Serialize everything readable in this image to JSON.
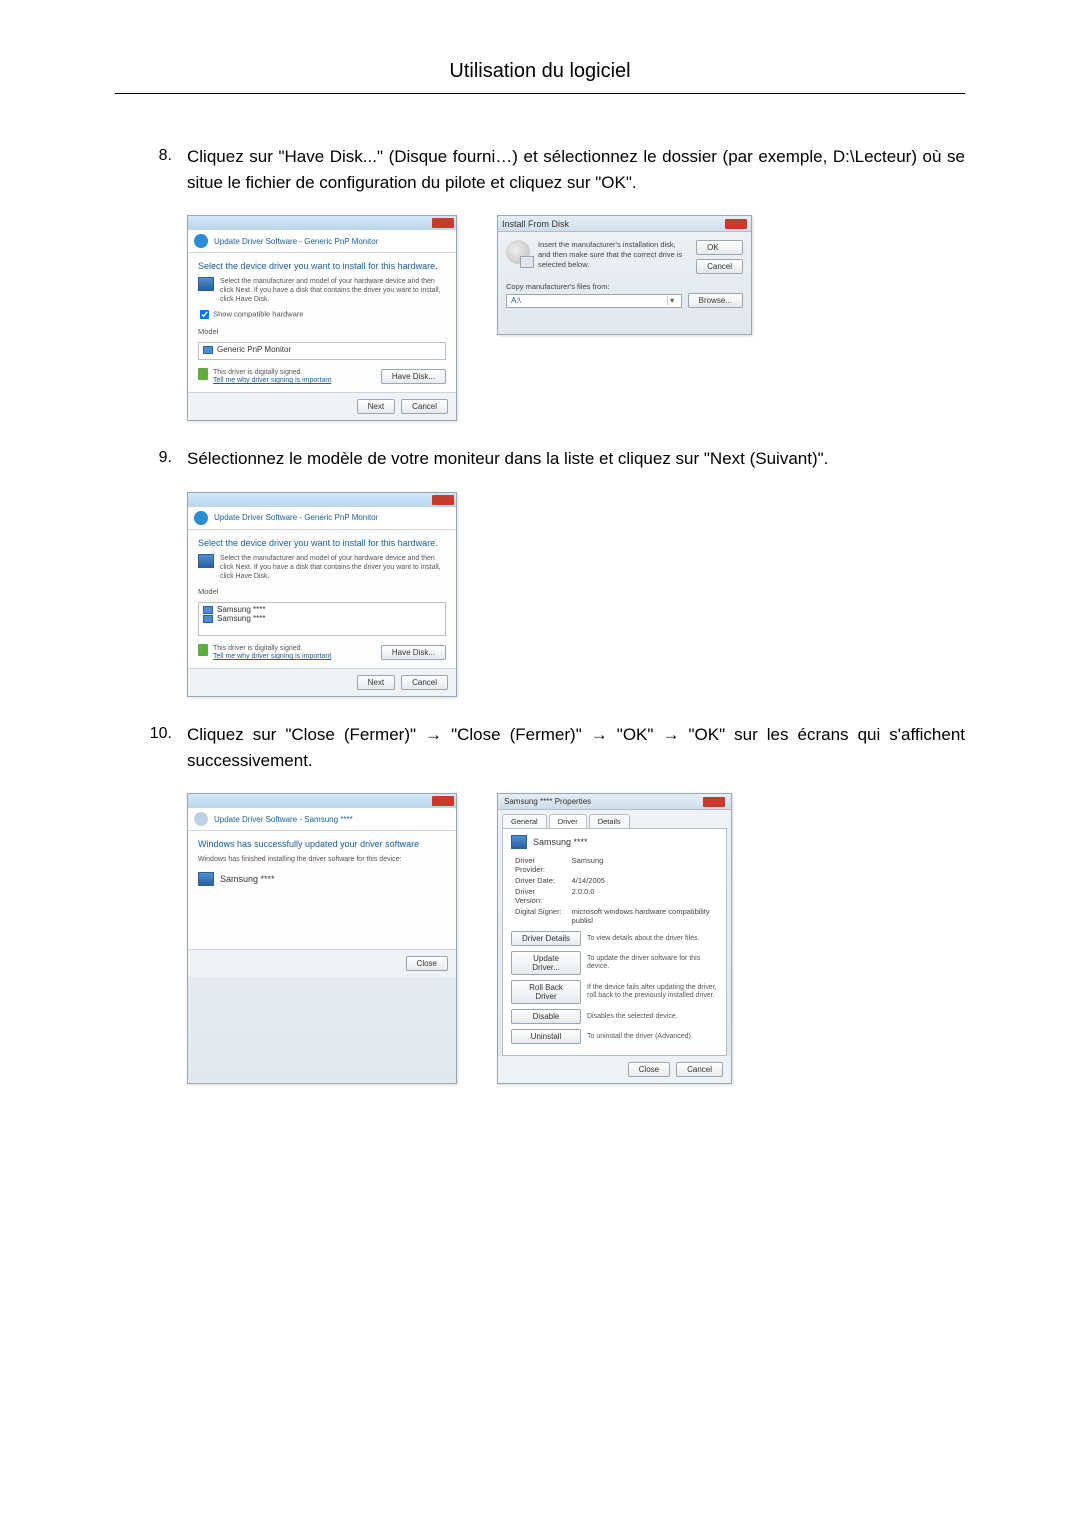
{
  "header": {
    "title": "Utilisation du logiciel"
  },
  "steps": {
    "s8": {
      "num": "8.",
      "text": "Cliquez sur \"Have Disk...\" (Disque fourni…) et sélectionnez le dossier (par exemple, D:\\Lecteur) où se situe le fichier de configuration du pilote et cliquez sur \"OK\"."
    },
    "s9": {
      "num": "9.",
      "text": "Sélectionnez le modèle de votre moniteur dans la liste et cliquez sur \"Next (Suivant)\"."
    },
    "s10": {
      "num": "10.",
      "text": "Cliquez sur \"Close (Fermer)\" → \"Close (Fermer)\" → \"OK\" → \"OK\" sur les écrans qui s'affichent successivement."
    }
  },
  "dlg_select1": {
    "title": "Update Driver Software - Generic PnP Monitor",
    "h1": "Select the device driver you want to install for this hardware.",
    "desc": "Select the manufacturer and model of your hardware device and then click Next. If you have a disk that contains the driver you want to install, click Have Disk.",
    "checkbox": "Show compatible hardware",
    "model_label": "Model",
    "model_item": "Generic PnP Monitor",
    "signed": "This driver is digitally signed.",
    "whylink": "Tell me why driver signing is important",
    "have_disk": "Have Disk...",
    "next": "Next",
    "cancel": "Cancel"
  },
  "dlg_ifd": {
    "title": "Install From Disk",
    "msg": "Insert the manufacturer's installation disk, and then make sure that the correct drive is selected below.",
    "ok": "OK",
    "cancel": "Cancel",
    "copyfrom": "Copy manufacturer's files from:",
    "path": "A:\\",
    "browse": "Browse..."
  },
  "dlg_select2": {
    "title": "Update Driver Software - Generic PnP Monitor",
    "h1": "Select the device driver you want to install for this hardware.",
    "desc": "Select the manufacturer and model of your hardware device and then click Next. If you have a disk that contains the driver you want to install, click Have Disk.",
    "model_label": "Model",
    "model_item1": "Samsung ****",
    "model_item2": "Samsung ****",
    "signed": "This driver is digitally signed.",
    "whylink": "Tell me why driver signing is important",
    "have_disk": "Have Disk...",
    "next": "Next",
    "cancel": "Cancel"
  },
  "dlg_success": {
    "title": "Update Driver Software - Samsung ****",
    "h1": "Windows has successfully updated your driver software",
    "line": "Windows has finished installing the driver software for this device:",
    "device": "Samsung ****",
    "close": "Close"
  },
  "dlg_props": {
    "title": "Samsung **** Properties",
    "tabs": {
      "general": "General",
      "driver": "Driver",
      "details": "Details"
    },
    "device": "Samsung ****",
    "fields": {
      "provider_l": "Driver Provider:",
      "provider_v": "Samsung",
      "date_l": "Driver Date:",
      "date_v": "4/14/2005",
      "version_l": "Driver Version:",
      "version_v": "2.0.0.0",
      "signer_l": "Digital Signer:",
      "signer_v": "microsoft windows hardware compatibility publisl"
    },
    "buttons": {
      "details": "Driver Details",
      "details_d": "To view details about the driver files.",
      "update": "Update Driver...",
      "update_d": "To update the driver software for this device.",
      "rollback": "Roll Back Driver",
      "rollback_d": "If the device fails after updating the driver, roll back to the previously installed driver.",
      "disable": "Disable",
      "disable_d": "Disables the selected device.",
      "uninstall": "Uninstall",
      "uninstall_d": "To uninstall the driver (Advanced)."
    },
    "close": "Close",
    "cancel": "Cancel"
  }
}
